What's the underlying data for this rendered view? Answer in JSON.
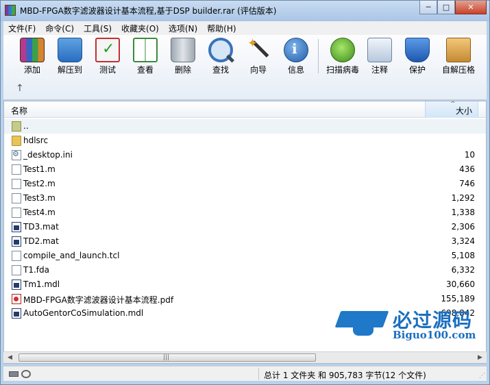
{
  "window": {
    "title": "MBD-FPGA数字滤波器设计基本流程,基于DSP builder.rar (评估版本)",
    "controls": {
      "minimize": "─",
      "maximize": "□",
      "close": "✕"
    }
  },
  "menu": [
    "文件(F)",
    "命令(C)",
    "工具(S)",
    "收藏夹(O)",
    "选项(N)",
    "帮助(H)"
  ],
  "toolbar": {
    "buttons": [
      {
        "label": "添加",
        "icon": "add-archive-icon"
      },
      {
        "label": "解压到",
        "icon": "extract-folder-icon"
      },
      {
        "label": "测试",
        "icon": "test-checklist-icon"
      },
      {
        "label": "查看",
        "icon": "view-book-icon"
      },
      {
        "label": "删除",
        "icon": "trash-can-icon"
      },
      {
        "label": "查找",
        "icon": "magnifier-icon"
      },
      {
        "label": "向导",
        "icon": "wizard-wand-icon"
      },
      {
        "label": "信息",
        "icon": "info-icon"
      },
      {
        "label": "扫描病毒",
        "icon": "virus-scan-icon"
      },
      {
        "label": "注释",
        "icon": "comment-icon"
      },
      {
        "label": "保护",
        "icon": "shield-icon"
      },
      {
        "label": "自解压格",
        "icon": "sfx-box-icon"
      }
    ],
    "up_arrow": "↑"
  },
  "filelist": {
    "headers": {
      "name": "名称",
      "size": "大小",
      "sort_indicator": "^"
    },
    "rows": [
      {
        "name": "..",
        "size": "",
        "type": "up"
      },
      {
        "name": "hdlsrc",
        "size": "",
        "type": "folder"
      },
      {
        "name": "_desktop.ini",
        "size": "10",
        "type": "ini"
      },
      {
        "name": "Test1.m",
        "size": "436",
        "type": "doc"
      },
      {
        "name": "Test2.m",
        "size": "746",
        "type": "doc"
      },
      {
        "name": "Test3.m",
        "size": "1,292",
        "type": "doc"
      },
      {
        "name": "Test4.m",
        "size": "1,338",
        "type": "doc"
      },
      {
        "name": "TD3.mat",
        "size": "2,306",
        "type": "mat"
      },
      {
        "name": "TD2.mat",
        "size": "3,324",
        "type": "mat"
      },
      {
        "name": "compile_and_launch.tcl",
        "size": "5,108",
        "type": "doc"
      },
      {
        "name": "T1.fda",
        "size": "6,332",
        "type": "doc"
      },
      {
        "name": "Tm1.mdl",
        "size": "30,660",
        "type": "mat"
      },
      {
        "name": "MBD-FPGA数字滤波器设计基本流程.pdf",
        "size": "155,189",
        "type": "pdf"
      },
      {
        "name": "AutoGentorCoSimulation.mdl",
        "size": "698,842",
        "type": "mat"
      }
    ]
  },
  "watermark": {
    "title": "必过源码",
    "domain": "Biguo100.com"
  },
  "scrollbar": {
    "left": "◀",
    "right": "▶",
    "grip": "|||"
  },
  "status": {
    "text": "总计 1 文件夹 和 905,783 字节(12 个文件)"
  }
}
